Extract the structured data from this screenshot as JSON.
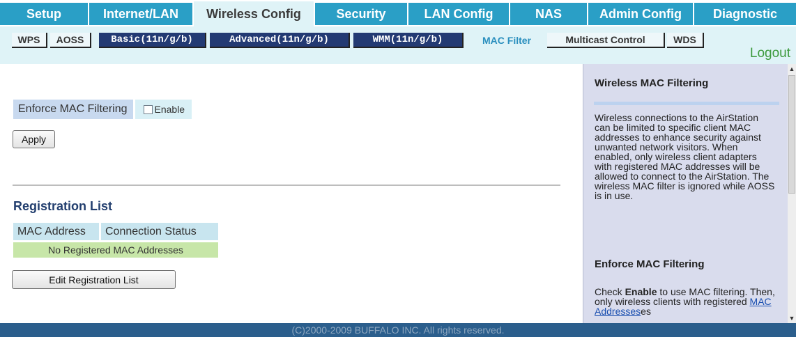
{
  "nav": {
    "tabs": [
      {
        "label": "Setup"
      },
      {
        "label": "Internet/LAN"
      },
      {
        "label": "Wireless Config"
      },
      {
        "label": "Security"
      },
      {
        "label": "LAN Config"
      },
      {
        "label": "NAS"
      },
      {
        "label": "Admin Config"
      },
      {
        "label": "Diagnostic"
      }
    ],
    "active_tab": "Wireless Config"
  },
  "subnav": {
    "items": [
      {
        "label": "WPS"
      },
      {
        "label": "AOSS"
      },
      {
        "label": "Basic(11n/g/b)"
      },
      {
        "label": "Advanced(11n/g/b)"
      },
      {
        "label": "WMM(11n/g/b)"
      },
      {
        "label": "MAC Filter"
      },
      {
        "label": "Multicast Control"
      },
      {
        "label": "WDS"
      }
    ],
    "current": "MAC Filter",
    "logout": "Logout"
  },
  "main": {
    "enforce_label": "Enforce MAC Filtering",
    "enable_label": "Enable",
    "enable_checked": false,
    "apply_label": "Apply",
    "registration_title": "Registration List",
    "table": {
      "headers": [
        "MAC Address",
        "Connection Status"
      ],
      "empty_message": "No Registered MAC Addresses"
    },
    "edit_label": "Edit Registration List"
  },
  "help": {
    "title": "Wireless MAC Filtering",
    "body": "Wireless connections to the AirStation can be limited to specific client MAC addresses to enhance security against unwanted network visitors. When enabled, only wireless client adapters with registered MAC addresses will be allowed to connect to the AirStation. The wireless MAC filter is ignored while AOSS is in use.",
    "subtitle": "Enforce MAC Filtering",
    "body2_pre": "Check ",
    "body2_bold": "Enable",
    "body2_mid": " to use MAC filtering. Then, only wireless clients with registered ",
    "body2_link": "MAC Addresses",
    "body2_post": "es"
  },
  "footer": {
    "text": "(C)2000-2009 BUFFALO INC. All rights reserved."
  },
  "colors": {
    "nav_tab": "#2a9fc6",
    "nav_active": "#dff3f7",
    "subnav_dark": "#233a73",
    "subnav_current": "#2a8fbe",
    "logout": "#3d9a3d",
    "help_panel": "#d9dced",
    "empty_row": "#c7e6a8",
    "footer": "#2b5e8c"
  }
}
